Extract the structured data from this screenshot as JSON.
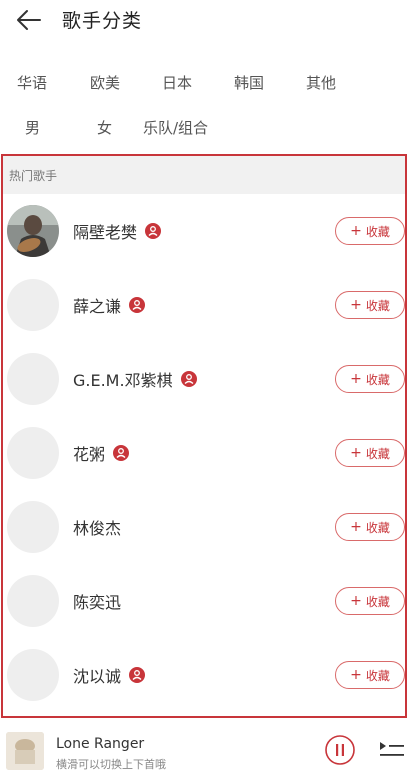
{
  "header": {
    "title": "歌手分类"
  },
  "categories": {
    "row1": [
      "华语",
      "欧美",
      "日本",
      "韩国",
      "其他"
    ],
    "row2": [
      "男",
      "女",
      "乐队/组合"
    ]
  },
  "hot_section": {
    "title": "热门歌手"
  },
  "collect_label": "收藏",
  "artists": [
    {
      "name": "隔壁老樊",
      "verified": true
    },
    {
      "name": "薛之谦",
      "verified": true
    },
    {
      "name": "G.E.M.邓紫棋",
      "verified": true
    },
    {
      "name": "花粥",
      "verified": true
    },
    {
      "name": "林俊杰",
      "verified": false
    },
    {
      "name": "陈奕迅",
      "verified": false
    },
    {
      "name": "沈以诚",
      "verified": true
    }
  ],
  "now_playing": {
    "title": "Lone Ranger",
    "subtitle": "横滑可以切换上下首哦"
  },
  "colors": {
    "accent": "#c8353a",
    "section_bg": "#f1f1f1",
    "avatar_placeholder": "#eeeeee"
  }
}
